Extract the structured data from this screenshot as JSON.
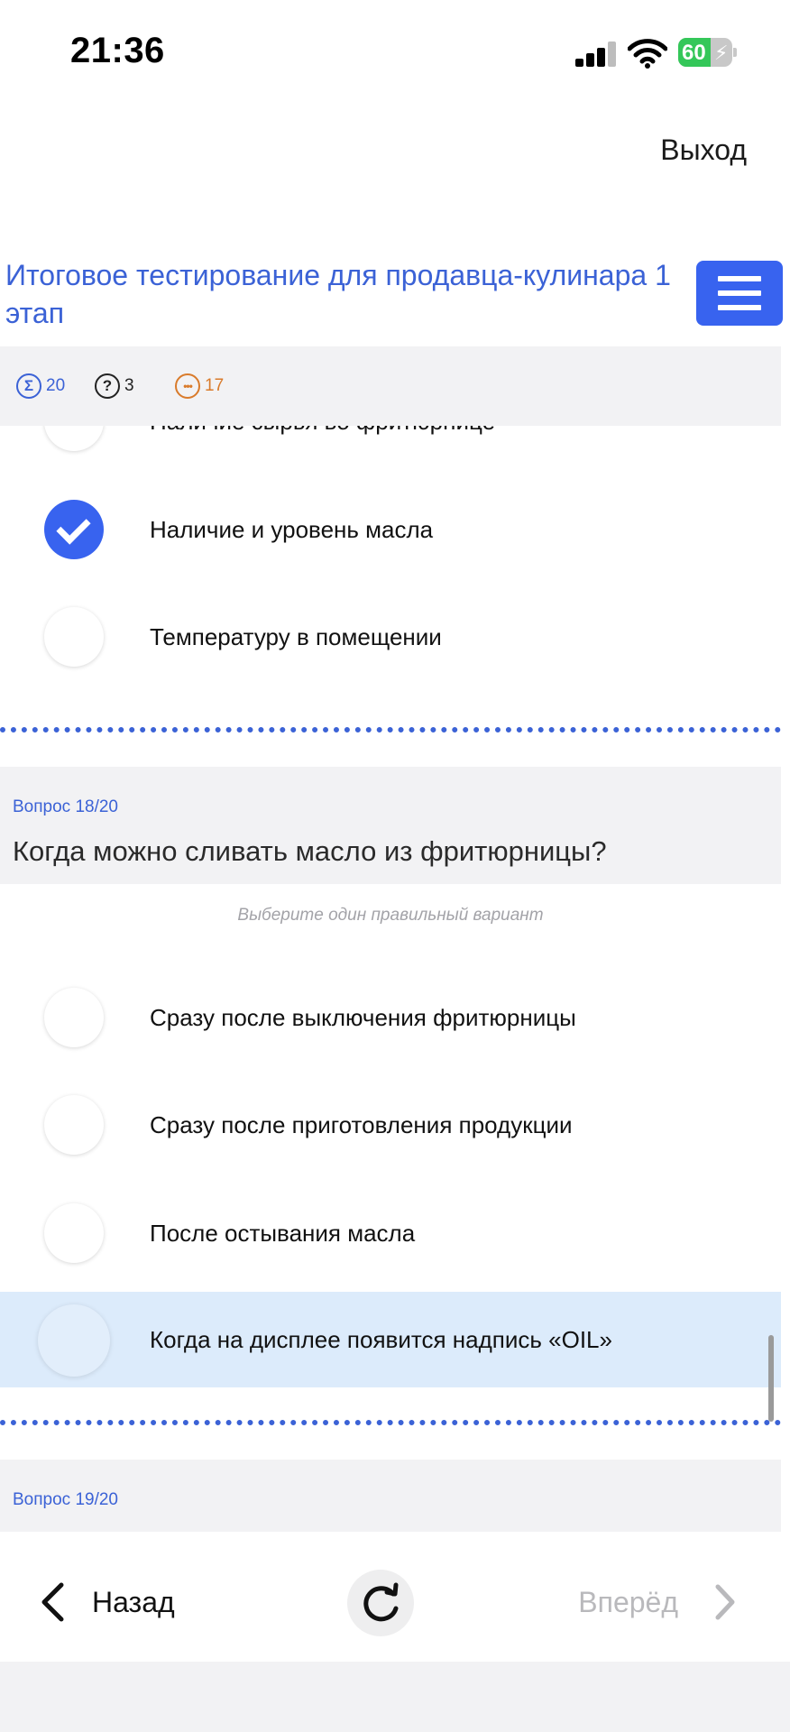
{
  "status_bar": {
    "time": "21:36",
    "battery_percent": "60",
    "battery_level": 0.6,
    "icons": [
      "signal-icon",
      "wifi-icon",
      "battery-charging-icon"
    ]
  },
  "header": {
    "exit_label": "Выход",
    "test_title": "Итоговое тестирование для продавца-кулинара 1 этап",
    "menu_icon": "hamburger-menu-icon"
  },
  "stats": {
    "total": "20",
    "unanswered": "3",
    "remaining": "17"
  },
  "prev_question": {
    "options": [
      {
        "label": "Наличие сырья во фритюрнице",
        "checked": false
      },
      {
        "label": "Наличие и уровень масла",
        "checked": true
      },
      {
        "label": "Температуру в помещении",
        "checked": false
      }
    ]
  },
  "question_18": {
    "number": "Вопрос 18/20",
    "text": "Когда можно сливать масло из фритюрницы?",
    "hint": "Выберите один правильный вариант",
    "options": [
      {
        "label": "Сразу после выключения фритюрницы",
        "checked": false
      },
      {
        "label": "Сразу после приготовления продукции",
        "checked": false
      },
      {
        "label": "После остывания масла",
        "checked": false
      },
      {
        "label": "Когда на дисплее появится надпись «OIL»",
        "checked": false,
        "highlighted": true
      }
    ]
  },
  "question_19": {
    "number": "Вопрос 19/20"
  },
  "bottom_nav": {
    "back_label": "Назад",
    "forward_label": "Вперёд"
  },
  "colors": {
    "accent": "#3863ef",
    "title_blue": "#3b62d6",
    "highlight_bg": "#dcebfb",
    "stat_orange": "#d97b2b"
  }
}
